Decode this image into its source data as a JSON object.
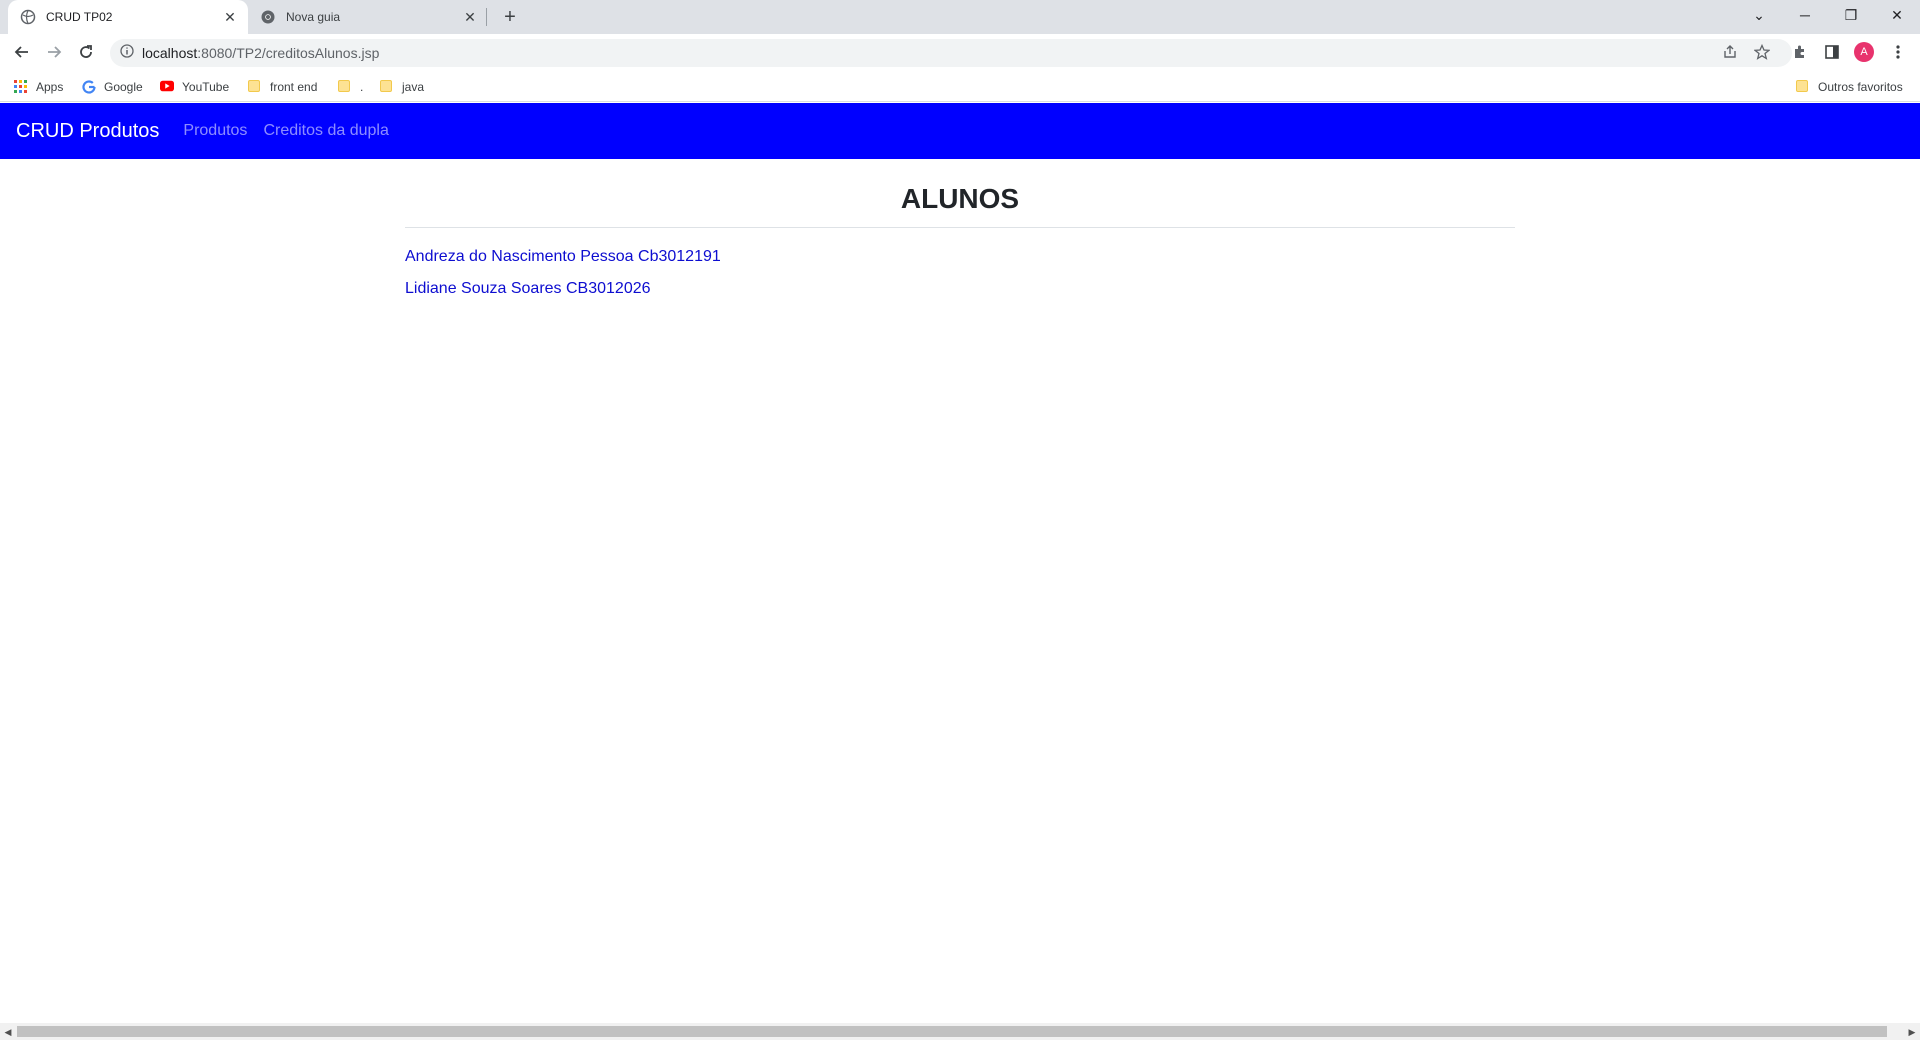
{
  "browser": {
    "tabs": [
      {
        "title": "CRUD TP02"
      },
      {
        "title": "Nova guia"
      }
    ],
    "url_host": "localhost",
    "url_rest": ":8080/TP2/creditosAlunos.jsp",
    "profile_initial": "A",
    "bookmarks": [
      {
        "label": "Apps"
      },
      {
        "label": "Google"
      },
      {
        "label": "YouTube"
      },
      {
        "label": "front end"
      },
      {
        "label": "."
      },
      {
        "label": "java"
      }
    ],
    "other_bookmarks": "Outros favoritos"
  },
  "navbar": {
    "brand": "CRUD Produtos",
    "links": [
      {
        "label": "Produtos"
      },
      {
        "label": "Creditos da dupla"
      }
    ],
    "color": "#0000ff"
  },
  "main": {
    "heading": "ALUNOS",
    "students": [
      {
        "label": "Andreza do Nascimento Pessoa Cb3012191"
      },
      {
        "label": "Lidiane Souza Soares CB3012026"
      }
    ]
  }
}
